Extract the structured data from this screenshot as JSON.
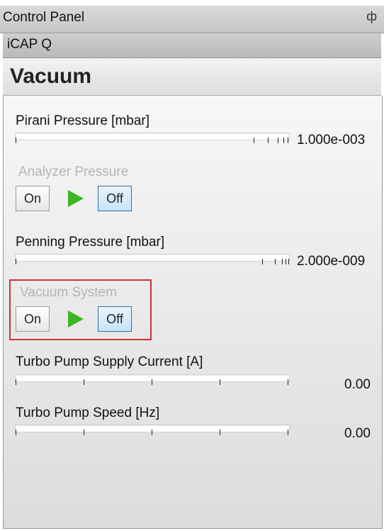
{
  "window": {
    "title": "Control Panel",
    "pin_glyph": "ꟸ"
  },
  "device": {
    "name": "iCAP Q"
  },
  "section": {
    "title": "Vacuum"
  },
  "pirani": {
    "label": "Pirani Pressure [mbar]",
    "value": "1.000e-003"
  },
  "analyzer": {
    "label": "Analyzer Pressure",
    "on_label": "On",
    "off_label": "Off",
    "state": "Off"
  },
  "penning": {
    "label": "Penning Pressure [mbar]",
    "value": "2.000e-009"
  },
  "vacuum_system": {
    "label": "Vacuum System",
    "on_label": "On",
    "off_label": "Off",
    "state": "Off"
  },
  "turbo_current": {
    "label": "Turbo Pump Supply Current [A]",
    "value": "0.00"
  },
  "turbo_speed": {
    "label": "Turbo Pump Speed [Hz]",
    "value": "0.00"
  },
  "colors": {
    "highlight": "#cc3333",
    "arrow": "#3cb522",
    "off_button": "#2d6fa8"
  },
  "icons": {
    "pin": "pin-icon",
    "play": "play-arrow-icon"
  }
}
